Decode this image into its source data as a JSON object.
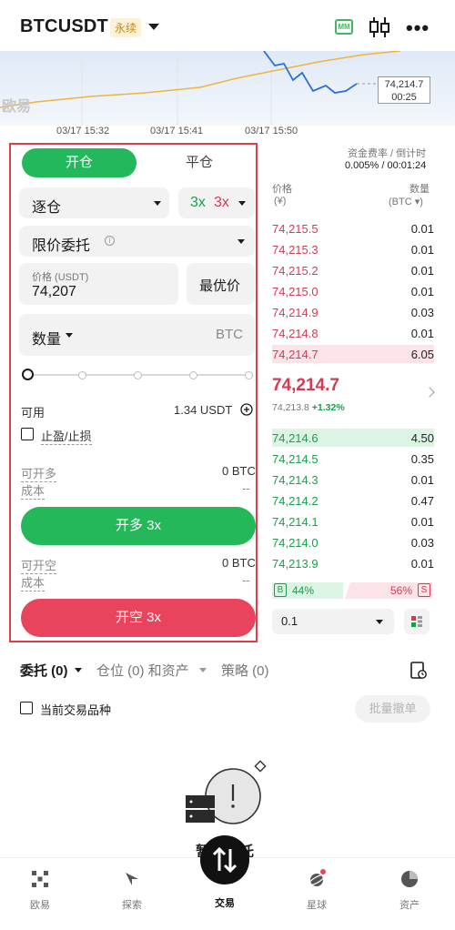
{
  "header": {
    "pair": "BTCUSDT",
    "contract_tag": "永续",
    "mm_label": "MM"
  },
  "chart": {
    "logo": "欧易",
    "price_tag_price": "74,214.7",
    "price_tag_countdown": "00:25",
    "time_labels": [
      "03/17 15:32",
      "03/17 15:41",
      "03/17 15:50"
    ]
  },
  "order_panel": {
    "tab_open": "开仓",
    "tab_close": "平仓",
    "margin_mode": "逐仓",
    "leverage_long": "3x",
    "leverage_short": "3x",
    "order_type": "限价委托",
    "price_label": "价格 (USDT)",
    "price_value": "74,207",
    "best_price_button": "最优价",
    "amount_label": "数量",
    "amount_unit": "BTC",
    "available_label": "可用",
    "available_value": "1.34 USDT",
    "tp_sl_label": "止盈/止损",
    "can_open_long_label": "可开多",
    "can_open_long_value": "0 BTC",
    "cost_label_long": "成本",
    "cost_value_long": "--",
    "open_long_button": "开多 3x",
    "can_open_short_label": "可开空",
    "can_open_short_value": "0 BTC",
    "cost_label_short": "成本",
    "cost_value_short": "--",
    "open_short_button": "开空 3x"
  },
  "orderbook": {
    "funding_label": "资金费率 / 倒计时",
    "funding_value": "0.005% / 00:01:24",
    "col_price": "价格",
    "col_price_unit": "(¥)",
    "col_qty": "数量",
    "col_qty_unit": "(BTC ▾)",
    "asks": [
      {
        "price": "74,215.5",
        "qty": "0.01"
      },
      {
        "price": "74,215.3",
        "qty": "0.01"
      },
      {
        "price": "74,215.2",
        "qty": "0.01"
      },
      {
        "price": "74,215.0",
        "qty": "0.01"
      },
      {
        "price": "74,214.9",
        "qty": "0.03"
      },
      {
        "price": "74,214.8",
        "qty": "0.01"
      },
      {
        "price": "74,214.7",
        "qty": "6.05"
      }
    ],
    "last_price": "74,214.7",
    "mark_price": "74,213.8",
    "change": "+1.32%",
    "bids": [
      {
        "price": "74,214.6",
        "qty": "4.50"
      },
      {
        "price": "74,214.5",
        "qty": "0.35"
      },
      {
        "price": "74,214.3",
        "qty": "0.01"
      },
      {
        "price": "74,214.2",
        "qty": "0.47"
      },
      {
        "price": "74,214.1",
        "qty": "0.01"
      },
      {
        "price": "74,214.0",
        "qty": "0.03"
      },
      {
        "price": "74,213.9",
        "qty": "0.01"
      }
    ],
    "buy_tag": "B",
    "buy_pct": "44%",
    "sell_pct": "56%",
    "sell_tag": "S",
    "depth_value": "0.1"
  },
  "bottom_tabs": {
    "orders": "委托 (0)",
    "positions": "仓位 (0) 和资产",
    "strategies": "策略 (0)",
    "current_only": "当前交易品种",
    "cancel_all": "批量撤单"
  },
  "empty_state": {
    "text": "暂无委托"
  },
  "nav": {
    "items": [
      "欧易",
      "探索",
      "交易",
      "星球",
      "资产"
    ]
  },
  "colors": {
    "green": "#23b85b",
    "red": "#e8445d",
    "highlight_border": "#e23c4b"
  }
}
